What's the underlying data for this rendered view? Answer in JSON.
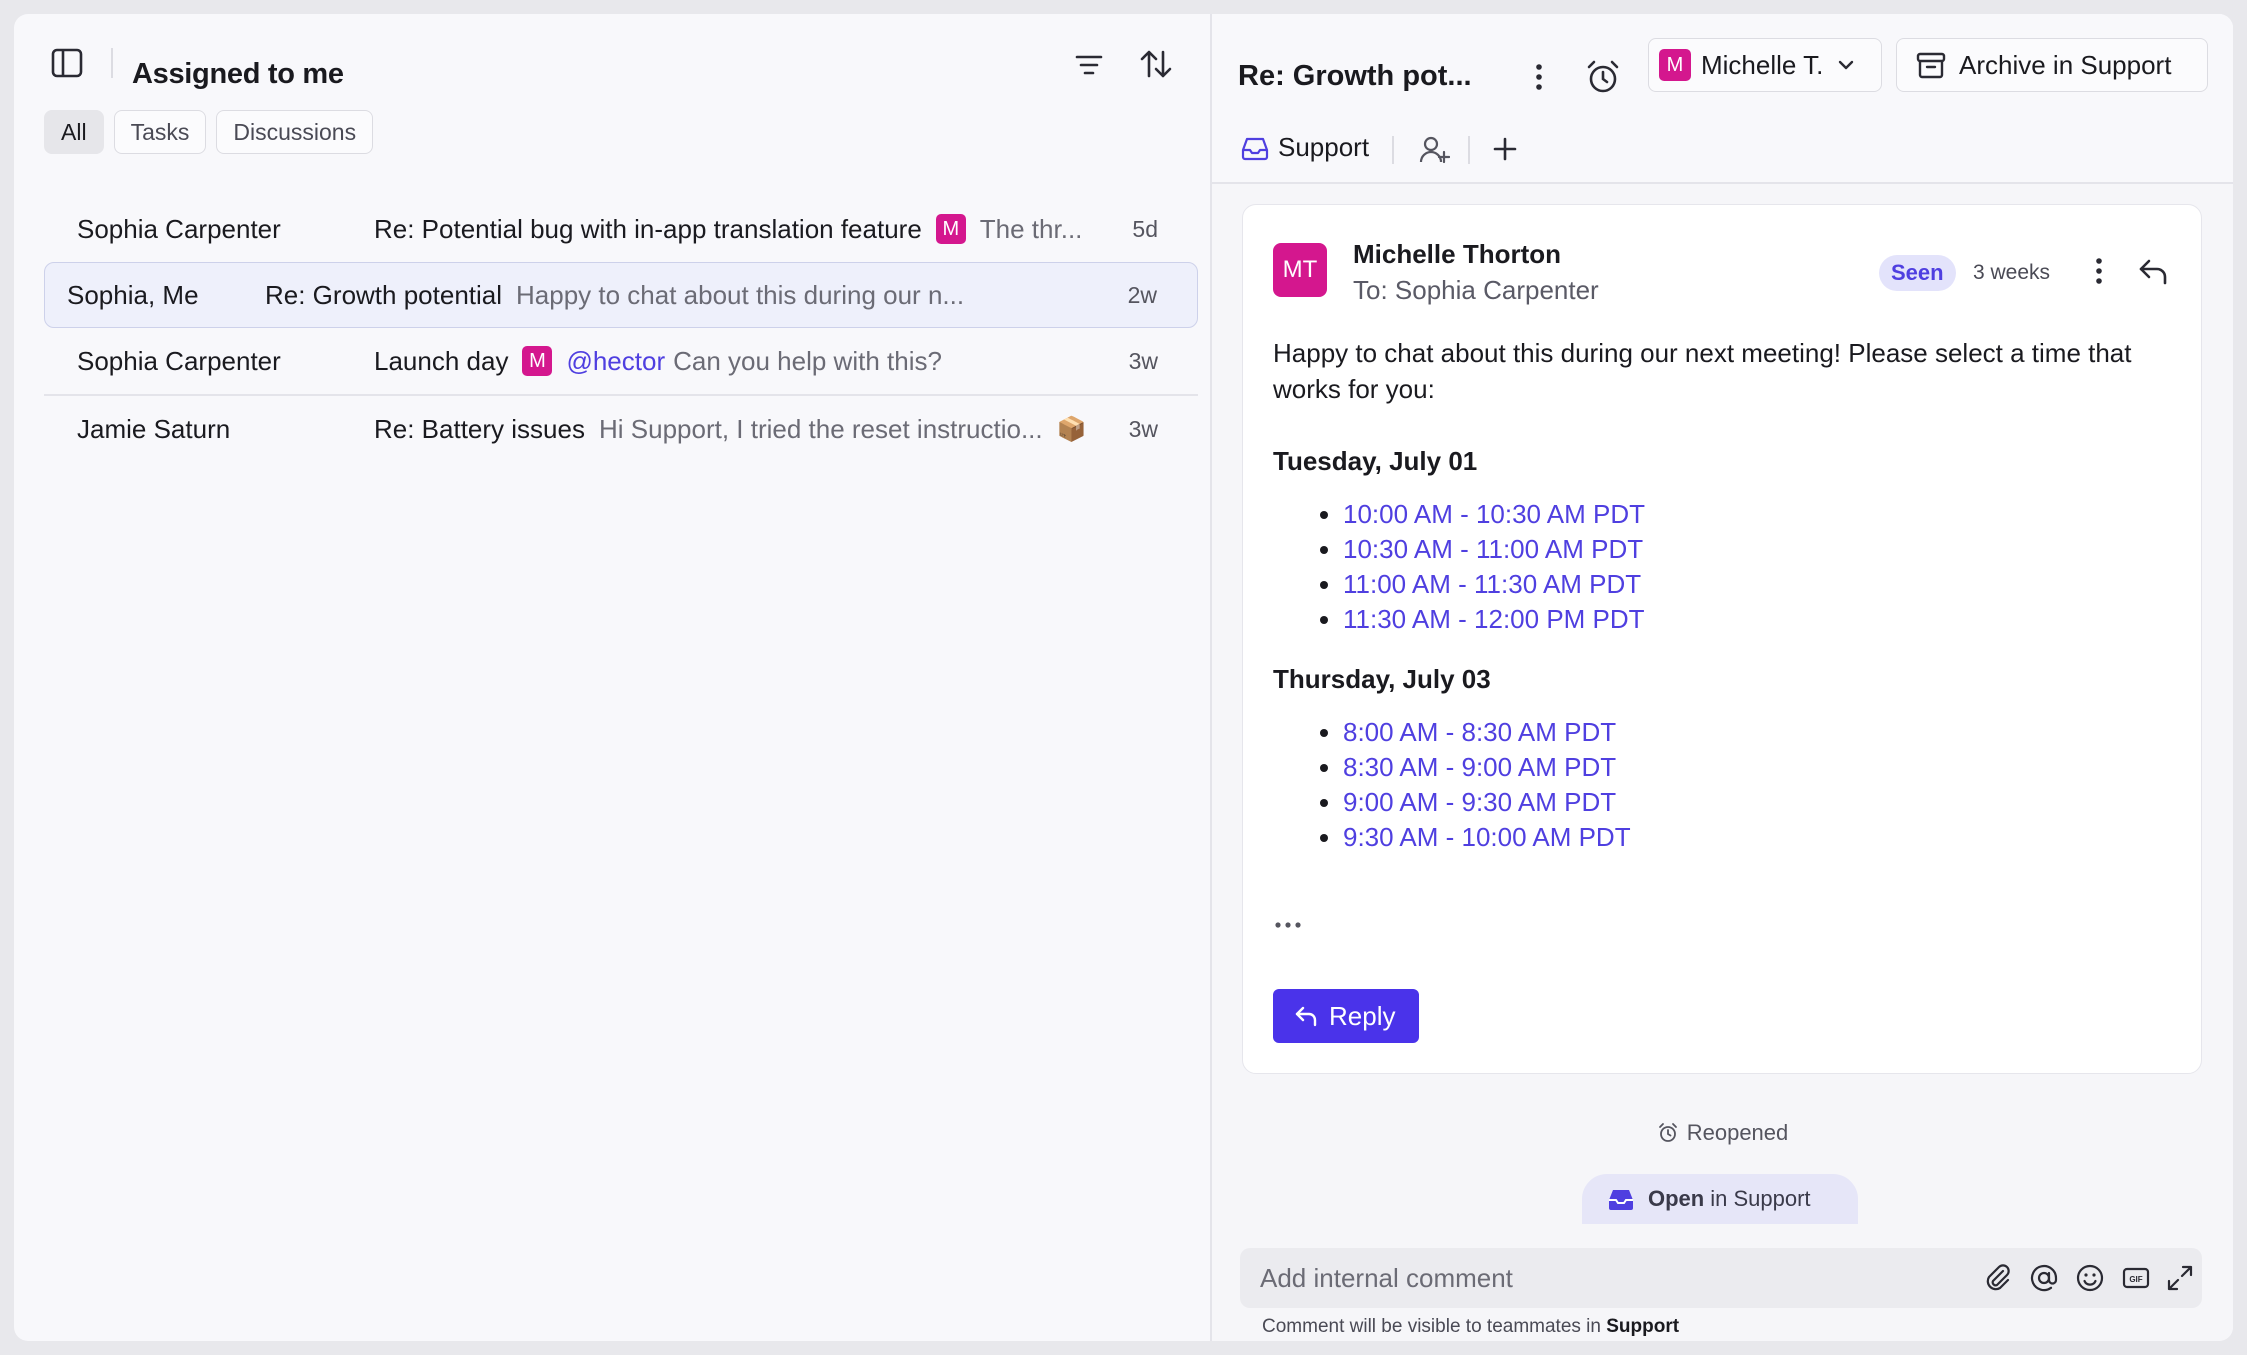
{
  "left": {
    "title": "Assigned to me",
    "tabs": [
      {
        "label": "All",
        "active": true
      },
      {
        "label": "Tasks",
        "active": false
      },
      {
        "label": "Discussions",
        "active": false
      }
    ],
    "rows": [
      {
        "sender": "Sophia Carpenter",
        "subject": "Re: Potential bug with in-app translation feature",
        "badge": "M",
        "preview": "The thr...",
        "age": "5d"
      },
      {
        "sender": "Sophia, Me",
        "subject": "Re: Growth potential",
        "preview": "Happy to chat about this during our n...",
        "age": "2w"
      },
      {
        "sender": "Sophia Carpenter",
        "subject": "Launch day",
        "badge": "M",
        "mention": "@hector",
        "preview": "Can you help with this?",
        "age": "3w"
      },
      {
        "sender": "Jamie Saturn",
        "subject": "Re: Battery issues",
        "preview": "Hi Support, I tried the reset instructio...",
        "emoji": "📦",
        "age": "3w"
      }
    ]
  },
  "right": {
    "thread_title": "Re: Growth pot...",
    "assignee": {
      "badge": "M",
      "name": "Michelle T."
    },
    "archive_label": "Archive in Support",
    "inbox_label": "Support",
    "message": {
      "avatar_initials": "MT",
      "from": "Michelle Thorton",
      "to": "To: Sophia Carpenter",
      "status": "Seen",
      "when": "3 weeks",
      "intro": "Happy to chat about this during our next meeting! Please select a time that works for you:",
      "days": [
        {
          "label": "Tuesday, July 01",
          "slots": [
            "10:00 AM - 10:30 AM PDT",
            "10:30 AM - 11:00 AM PDT",
            "11:00 AM - 11:30 AM PDT",
            "11:30 AM - 12:00 PM PDT"
          ]
        },
        {
          "label": "Thursday, July 03",
          "slots": [
            "8:00 AM - 8:30 AM PDT",
            "8:30 AM - 9:00 AM PDT",
            "9:00 AM - 9:30 AM PDT",
            "9:30 AM - 10:00 AM PDT"
          ]
        }
      ],
      "reply_label": "Reply"
    },
    "event_reopened": "Reopened",
    "open_pill": {
      "open": "Open",
      "rest": "in Support"
    },
    "comment": {
      "placeholder": "Add internal comment",
      "note_prefix": "Comment will be visible to teammates in",
      "note_team": "Support"
    }
  },
  "colors": {
    "accent": "#4a33ea",
    "link": "#4f3fe0",
    "badge": "#d4178e"
  },
  "icons": [
    "sidebar-toggle-icon",
    "filter-icon",
    "sort-icon",
    "more-vertical-icon",
    "alarm-clock-icon",
    "chevron-down-icon",
    "archive-icon",
    "inbox-icon",
    "add-person-icon",
    "plus-icon",
    "reply-icon",
    "paperclip-icon",
    "at-icon",
    "emoji-icon",
    "gif-icon",
    "expand-icon"
  ]
}
